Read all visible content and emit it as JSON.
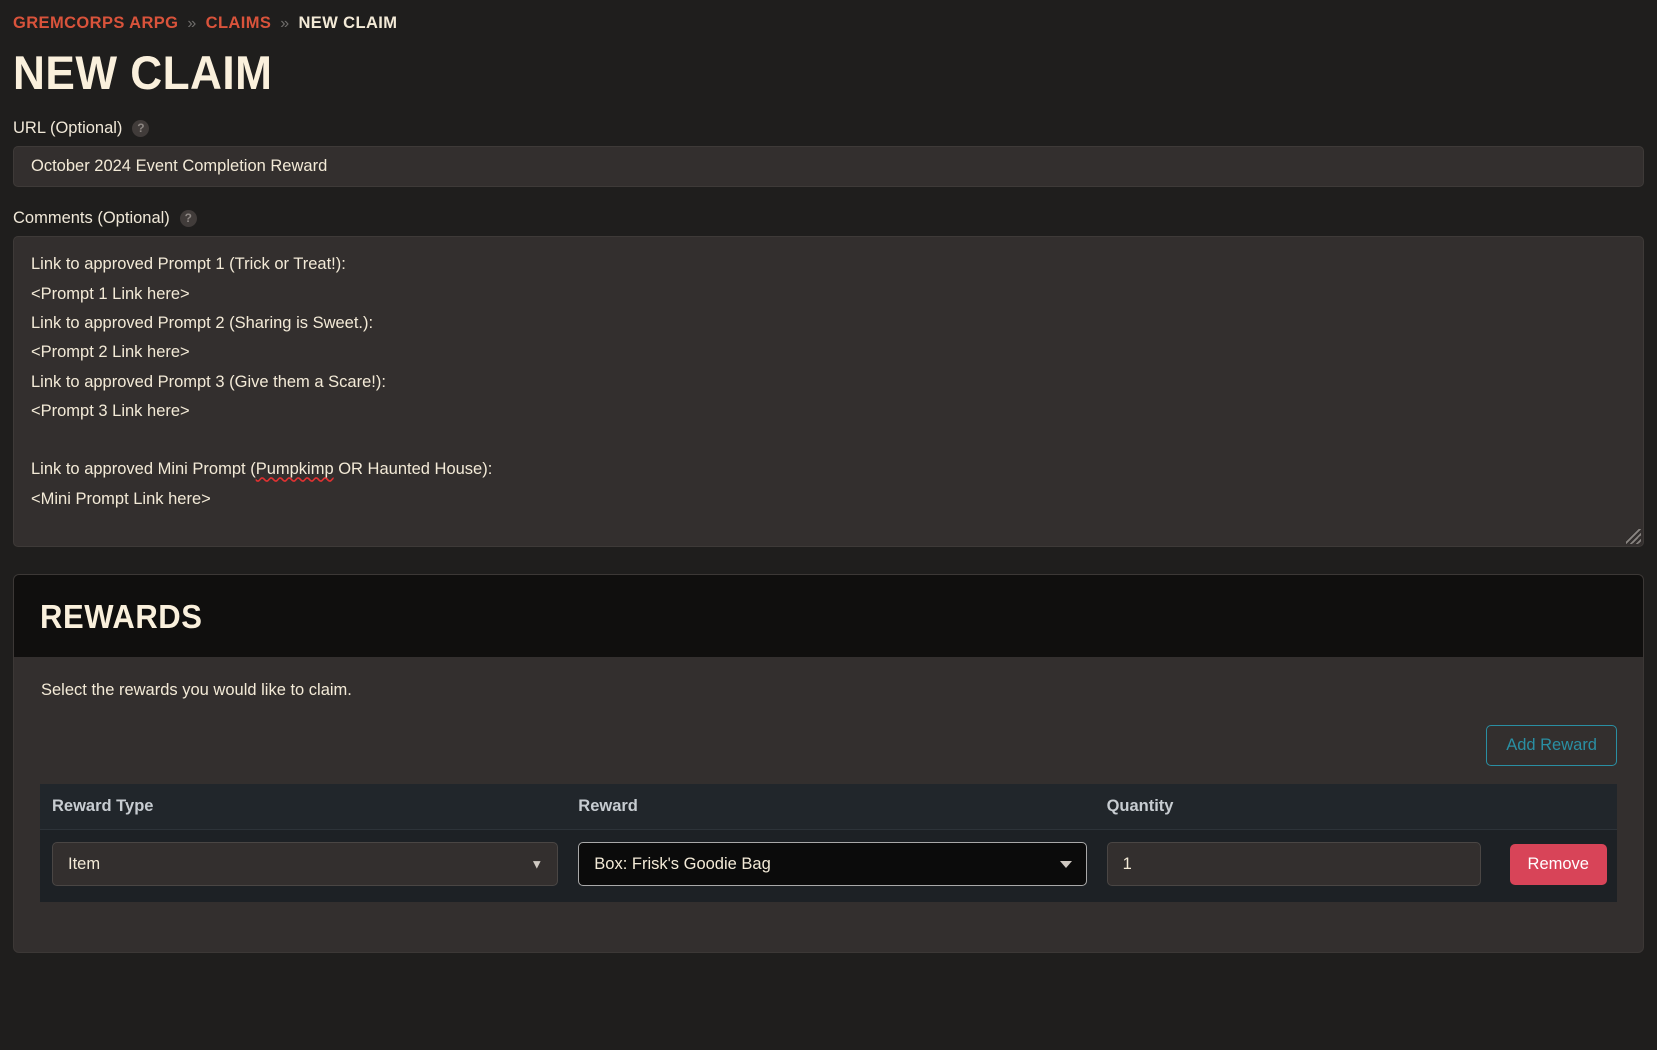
{
  "breadcrumb": {
    "items": [
      {
        "label": "GREMCORPS ARPG",
        "current": false
      },
      {
        "label": "CLAIMS",
        "current": false
      },
      {
        "label": "NEW CLAIM",
        "current": true
      }
    ],
    "separator": "»"
  },
  "page": {
    "title": "NEW CLAIM"
  },
  "form": {
    "url": {
      "label": "URL (Optional)",
      "help_icon": "question-mark-icon",
      "value": "October 2024 Event Completion Reward",
      "placeholder": ""
    },
    "comments": {
      "label": "Comments (Optional)",
      "help_icon": "question-mark-icon",
      "lines": [
        {
          "text": "Link to approved Prompt 1 (Trick or Treat!):",
          "misspelled": ""
        },
        {
          "text": "<Prompt 1 Link here>",
          "misspelled": ""
        },
        {
          "text": "Link to approved Prompt 2 (Sharing is Sweet.):",
          "misspelled": ""
        },
        {
          "text": "<Prompt 2 Link here>",
          "misspelled": ""
        },
        {
          "text": "Link to approved Prompt 3 (Give them a Scare!):",
          "misspelled": ""
        },
        {
          "text": "<Prompt 3 Link here>",
          "misspelled": ""
        },
        {
          "text": "",
          "misspelled": ""
        },
        {
          "pre": "Link to approved Mini Prompt (",
          "misspelled": "Pumpkimp",
          "post": " OR Haunted House):"
        },
        {
          "text": "<Mini Prompt Link here>",
          "misspelled": ""
        }
      ]
    }
  },
  "rewards": {
    "heading": "REWARDS",
    "intro": "Select the rewards you would like to claim.",
    "add_button": "Add Reward",
    "columns": [
      "Reward Type",
      "Reward",
      "Quantity",
      ""
    ],
    "rows": [
      {
        "reward_type": "Item",
        "reward": "Box: Frisk's Goodie Bag",
        "quantity": "1",
        "remove_label": "Remove"
      }
    ]
  },
  "colors": {
    "page_bg": "#1f1e1d",
    "card_bg": "#332f2e",
    "card_header_bg": "#100f0e",
    "accent_breadcrumb": "#d9533b",
    "text_cream": "#f3ead7",
    "add_button": "#2a8fa3",
    "remove_button": "#d84458",
    "table_bg": "#1d2125",
    "table_header_bg": "#21262b",
    "spellcheck_underline": "#e03131"
  }
}
